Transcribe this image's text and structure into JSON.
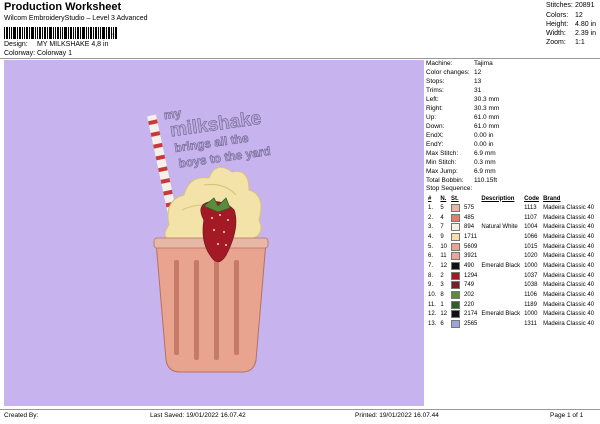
{
  "header": {
    "title": "Production Worksheet",
    "software": "Wilcom EmbroideryStudio – Level 3 Advanced",
    "barcode_suffix": ",",
    "design_label": "Design:",
    "design_value": "MY MILKSHAKE 4,8 in",
    "colorway_label": "Colorway:",
    "colorway_value": "Colorway 1"
  },
  "summary": [
    {
      "label": "Stitches:",
      "value": "20891"
    },
    {
      "label": "Colors:",
      "value": "12"
    },
    {
      "label": "Height:",
      "value": "4.80 in"
    },
    {
      "label": "Width:",
      "value": "2.39 in"
    },
    {
      "label": "Zoom:",
      "value": "1:1"
    }
  ],
  "design_text": [
    "my",
    "milkshake",
    "brings all the",
    "boys to the yard"
  ],
  "machine_stats": [
    {
      "label": "Machine:",
      "value": "Tajima"
    },
    {
      "label": "Color changes:",
      "value": "12"
    },
    {
      "label": "Stops:",
      "value": "13"
    },
    {
      "label": "Trims:",
      "value": "31"
    },
    {
      "label": "Left:",
      "value": "30.3 mm"
    },
    {
      "label": "Right:",
      "value": "30.3 mm"
    },
    {
      "label": "Up:",
      "value": "61.0 mm"
    },
    {
      "label": "Down:",
      "value": "61.0 mm"
    },
    {
      "label": "EndX:",
      "value": "0.00 in"
    },
    {
      "label": "EndY:",
      "value": "0.00 in"
    },
    {
      "label": "Max Stitch:",
      "value": "6.9 mm"
    },
    {
      "label": "Min Stitch:",
      "value": "0.3 mm"
    },
    {
      "label": "Max Jump:",
      "value": "6.9 mm"
    },
    {
      "label": "Total Bobbin:",
      "value": "110.15ft"
    }
  ],
  "stop_sequence": {
    "title": "Stop Sequence:",
    "columns": [
      "#",
      "N.",
      "St.",
      "Description",
      "Code",
      "Brand"
    ],
    "rows": [
      {
        "n": "1.",
        "num": "5",
        "color": "#e8b8a6",
        "st": "575",
        "desc": "",
        "code": "1113",
        "brand": "Madeira Classic 40"
      },
      {
        "n": "2.",
        "num": "4",
        "color": "#e37d6e",
        "st": "485",
        "desc": "",
        "code": "1107",
        "brand": "Madeira Classic 40"
      },
      {
        "n": "3.",
        "num": "7",
        "color": "#f6f1e4",
        "st": "894",
        "desc": "Natural White",
        "code": "1004",
        "brand": "Madeira Classic 40"
      },
      {
        "n": "4.",
        "num": "9",
        "color": "#f4dfa6",
        "st": "1711",
        "desc": "",
        "code": "1066",
        "brand": "Madeira Classic 40"
      },
      {
        "n": "5.",
        "num": "10",
        "color": "#e9a490",
        "st": "5609",
        "desc": "",
        "code": "1015",
        "brand": "Madeira Classic 40"
      },
      {
        "n": "6.",
        "num": "11",
        "color": "#f1a29b",
        "st": "3921",
        "desc": "",
        "code": "1020",
        "brand": "Madeira Classic 40"
      },
      {
        "n": "7.",
        "num": "12",
        "color": "#111111",
        "st": "490",
        "desc": "Emerald Black",
        "code": "1000",
        "brand": "Madeira Classic 40"
      },
      {
        "n": "8.",
        "num": "2",
        "color": "#a31a25",
        "st": "1294",
        "desc": "",
        "code": "1037",
        "brand": "Madeira Classic 40"
      },
      {
        "n": "9.",
        "num": "3",
        "color": "#7b1d27",
        "st": "749",
        "desc": "",
        "code": "1038",
        "brand": "Madeira Classic 40"
      },
      {
        "n": "10.",
        "num": "8",
        "color": "#5e8a3c",
        "st": "202",
        "desc": "",
        "code": "1106",
        "brand": "Madeira Classic 40"
      },
      {
        "n": "11.",
        "num": "1",
        "color": "#2f5e2a",
        "st": "220",
        "desc": "",
        "code": "1189",
        "brand": "Madeira Classic 40"
      },
      {
        "n": "12.",
        "num": "12",
        "color": "#111111",
        "st": "2174",
        "desc": "Emerald Black",
        "code": "1000",
        "brand": "Madeira Classic 40"
      },
      {
        "n": "13.",
        "num": "6",
        "color": "#9aa6d8",
        "st": "2565",
        "desc": "",
        "code": "1311",
        "brand": "Madeira Classic 40"
      }
    ]
  },
  "footer": {
    "created_by": "Created By:",
    "last_saved": "Last Saved: 19/01/2022 16.07.42",
    "printed": "Printed: 19/01/2022 16.07.44",
    "page": "Page 1 of 1"
  },
  "colors": {
    "canvas_bg": "#c7b3ee"
  }
}
